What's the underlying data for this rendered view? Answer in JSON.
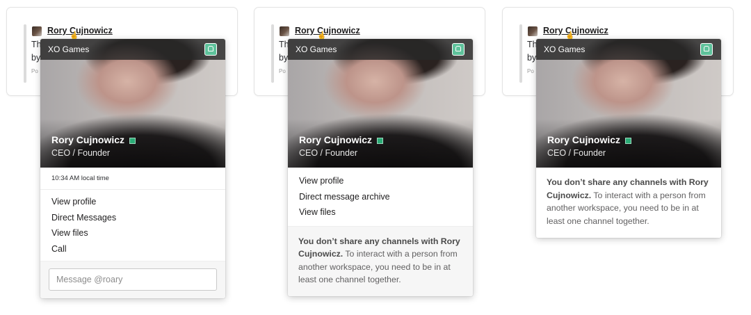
{
  "panels": [
    {
      "message": {
        "sender": "Rory Cujnowicz",
        "line1": "Th",
        "line2": "by",
        "meta": "Po"
      },
      "workspace": "XO Games",
      "profile": {
        "name": "Rory Cujnowicz",
        "title": "CEO / Founder"
      },
      "local_time": "10:34 AM local time",
      "menu": [
        "View profile",
        "Direct Messages",
        "View files",
        "Call"
      ],
      "input_placeholder": "Message @roary"
    },
    {
      "message": {
        "sender": "Rory Cujnowicz",
        "line1": "Th",
        "line2": "by",
        "meta": "Po"
      },
      "workspace": "XO Games",
      "profile": {
        "name": "Rory Cujnowicz",
        "title": "CEO / Founder"
      },
      "menu": [
        "View profile",
        "Direct message archive",
        "View files"
      ],
      "notice": {
        "bold": "You don’t share any channels with Rory Cujnowicz.",
        "text": " To interact with a person from another workspace, you need to be in at least one channel together."
      }
    },
    {
      "message": {
        "sender": "Rory Cujnowicz",
        "line1": "Th",
        "line2": "by",
        "meta": "Po"
      },
      "workspace": "XO Games",
      "profile": {
        "name": "Rory Cujnowicz",
        "title": "CEO / Founder"
      },
      "notice": {
        "bold": "You don’t share any channels with Rory Cujnowicz.",
        "text": " To interact with a person from another workspace, you need to be in at least one channel together."
      }
    }
  ],
  "colors": {
    "presence": "#2bac76",
    "workspace_icon": "#5ec29b",
    "header_bar": "#282828"
  },
  "icons": {
    "workspace": "workspace-badge-icon",
    "cursor": "hand-cursor-icon"
  }
}
